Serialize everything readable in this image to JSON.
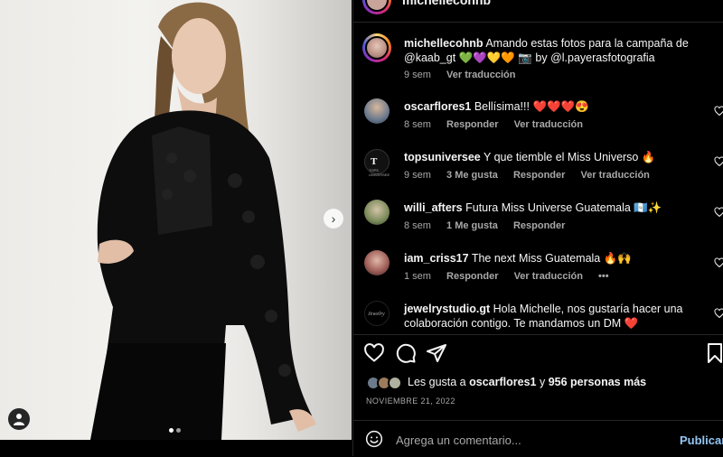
{
  "header": {
    "username": "michellecohnb"
  },
  "caption": {
    "username": "michellecohnb",
    "text": "Amando estas fotos para la campaña de @kaab_gt 💚💜💛🧡 📷 by @l.payerasfotografia",
    "time": "9 sem",
    "translate": "Ver traducción"
  },
  "comments": [
    {
      "username": "oscarflores1",
      "text": "Bellísima!!! ❤️❤️❤️😍",
      "time": "8 sem",
      "likes": "",
      "reply": "Responder",
      "translate": "Ver traducción",
      "more": ""
    },
    {
      "username": "topsuniversee",
      "text": "Y que tiemble el Miss Universo 🔥",
      "time": "9 sem",
      "likes": "3 Me gusta",
      "reply": "Responder",
      "translate": "Ver traducción",
      "more": ""
    },
    {
      "username": "willi_afters",
      "text": "Futura Miss Universe Guatemala 🇬🇹✨",
      "time": "8 sem",
      "likes": "1 Me gusta",
      "reply": "Responder",
      "translate": "",
      "more": ""
    },
    {
      "username": "iam_criss17",
      "text": "The next Miss Guatemala 🔥🙌",
      "time": "1 sem",
      "likes": "",
      "reply": "Responder",
      "translate": "Ver traducción",
      "more": "•••"
    },
    {
      "username": "jewelrystudio.gt",
      "text": "Hola Michelle, nos gustaría hacer una colaboración contigo. Te mandamos un DM ❤️",
      "time": "",
      "likes": "",
      "reply": "",
      "translate": "",
      "more": ""
    }
  ],
  "avatar_labels": {
    "tops": "T",
    "tops_sub": "TOPS UNIVERSEE",
    "jewelry": "Jewelry"
  },
  "likes": {
    "prefix": "Les gusta a",
    "user": "oscarflores1",
    "joiner": "y",
    "others": "956 personas más"
  },
  "date": "NOVIEMBRE 21, 2022",
  "comment_box": {
    "placeholder": "Agrega un comentario...",
    "publish": "Publicar"
  },
  "carousel": {
    "next": "›",
    "slides": 2,
    "active": 1
  },
  "colors": {
    "accent": "#93c7f5",
    "muted": "#a8a8a8",
    "background": "#000000",
    "heart": "#ed4956"
  },
  "icons": [
    "heart-icon",
    "comment-icon",
    "share-icon",
    "bookmark-icon",
    "emoji-icon",
    "user-tag-icon",
    "chevron-right-icon"
  ]
}
